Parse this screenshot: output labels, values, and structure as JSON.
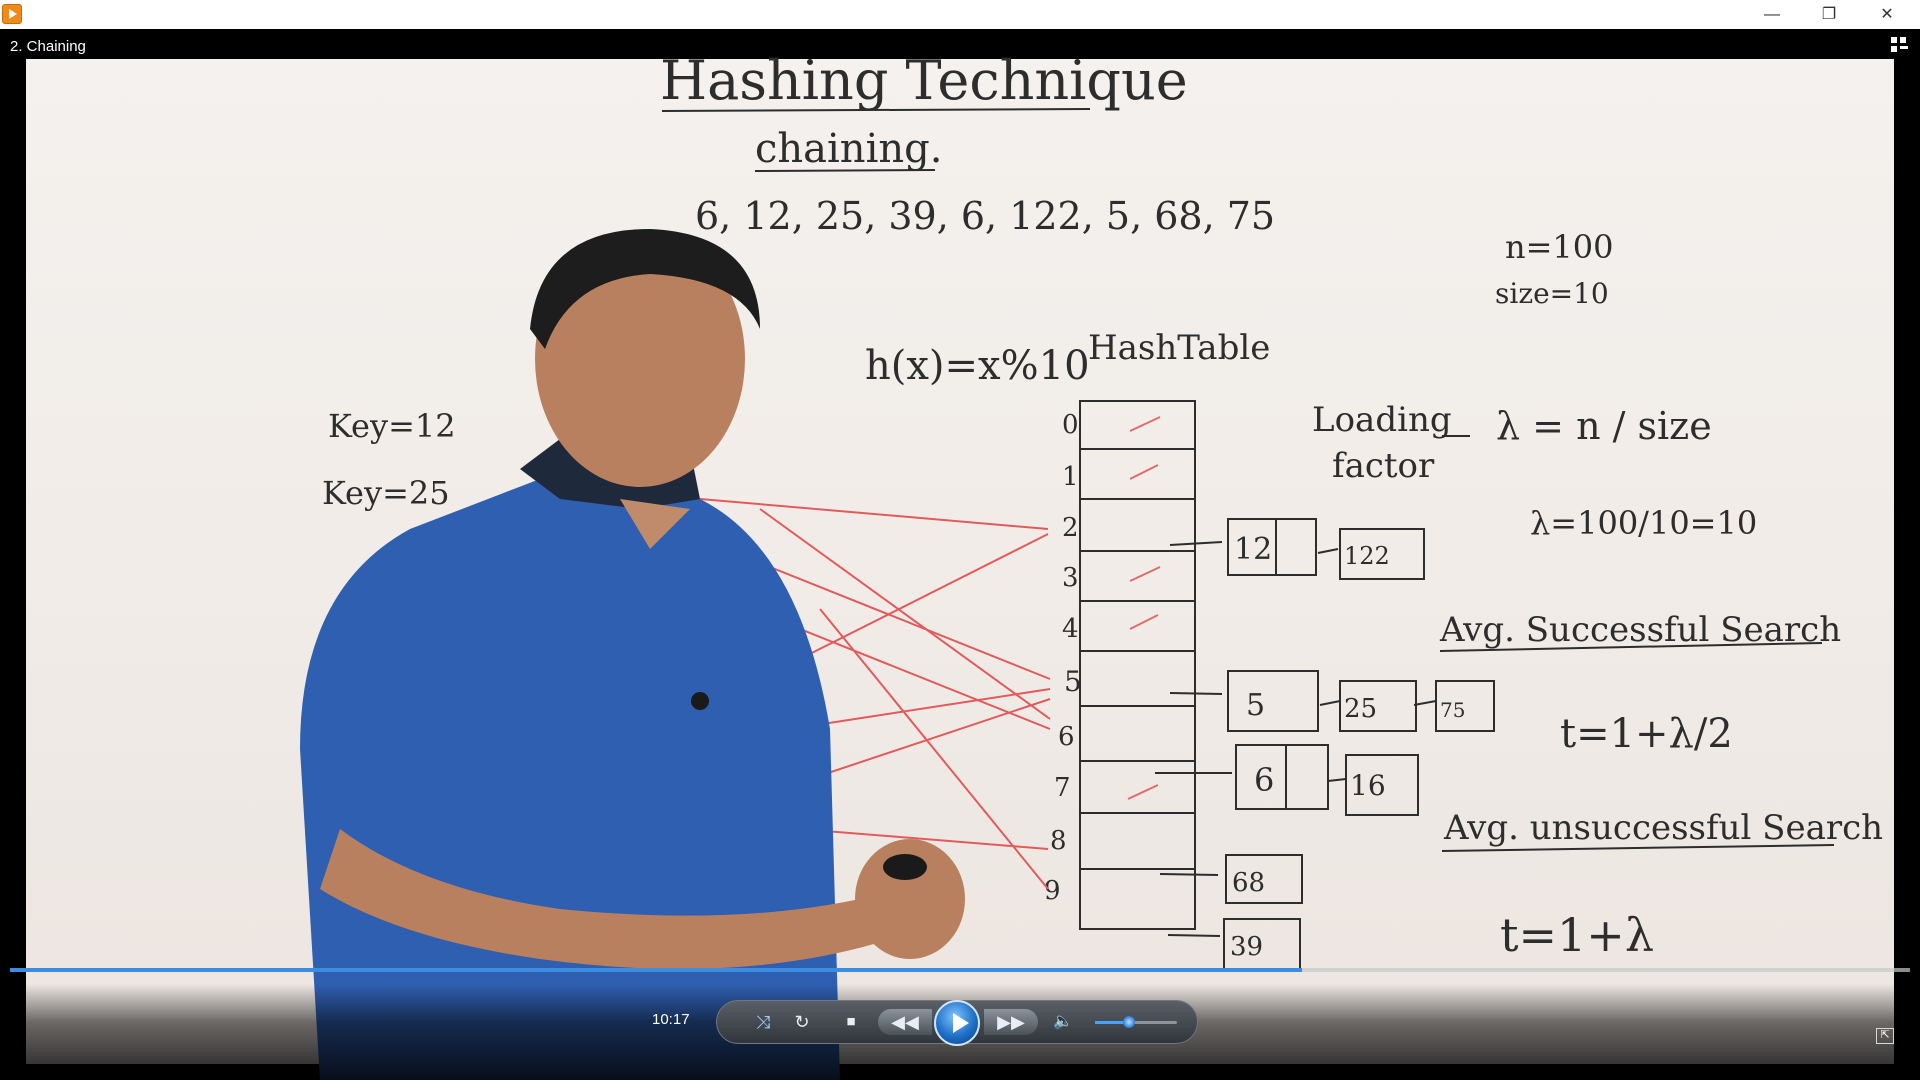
{
  "window": {
    "close_symbol": "✕",
    "minimize_symbol": "—",
    "restore_symbol": "❐",
    "icon": "media-player-icon"
  },
  "video": {
    "title": "2. Chaining",
    "progress_fraction": 0.68
  },
  "board": {
    "heading": "Hashing Technique",
    "subheading": "chaining.",
    "keys": "6, 12, 25, 39, 6, 122, 5, 68, 75",
    "n": "n=100",
    "size": "size=10",
    "hash_function": "h(x)=x%10",
    "hash_table_label": "HashTable",
    "key_12": "Key=12",
    "key_25": "Key=25",
    "loading": "Loading",
    "factor": "factor",
    "lambda_def": "λ = n / size",
    "lambda_calc": "λ=100/10=10",
    "avg_success": "Avg. Successful Search",
    "t_success": "t=1+λ/2",
    "avg_unsuccess": "Avg. unsuccessful Search",
    "t_unsuccess": "t=1+λ",
    "indices": [
      "0",
      "1",
      "2",
      "3",
      "4",
      "5",
      "6",
      "7",
      "8",
      "9"
    ],
    "chain_12": "12",
    "chain_122": "122",
    "chain_5": "5",
    "chain_25": "25",
    "chain_75": "75",
    "chain_6": "6",
    "chain_16": "16",
    "chain_68": "68",
    "chain_39": "39"
  },
  "controls": {
    "time": "10:17",
    "volume_fraction": 0.42,
    "colors": {
      "accent": "#3b8de2"
    }
  }
}
